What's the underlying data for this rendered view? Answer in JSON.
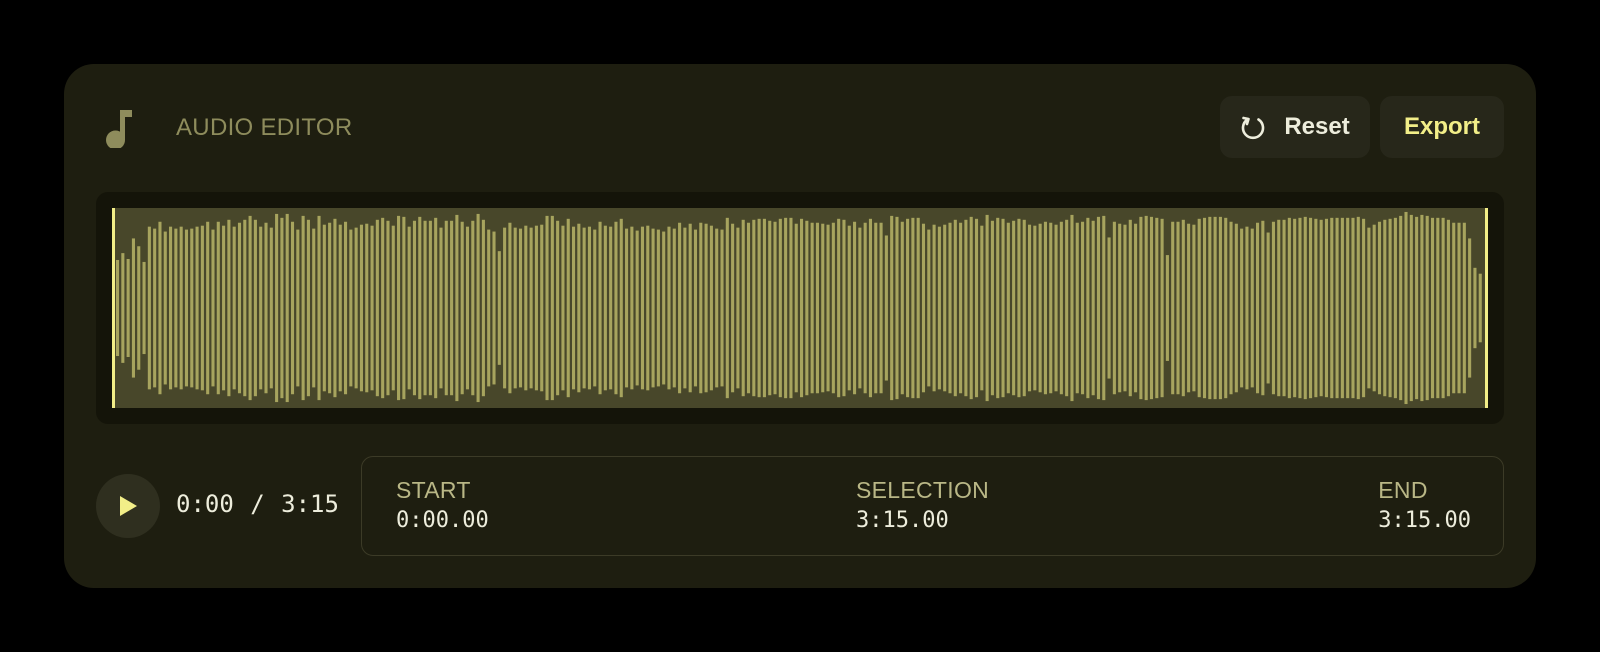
{
  "header": {
    "title": "AUDIO EDITOR",
    "logo_icon": "music-note-icon",
    "reset_label": "Reset",
    "reset_icon": "rotate-ccw-icon",
    "export_label": "Export"
  },
  "waveform": {
    "bar_color": "#a7a45e",
    "selection_fill": "#48472a",
    "handle_color": "#f2ee88",
    "selection_start_fraction": 0.0,
    "selection_end_fraction": 1.0,
    "amplitudes": [
      0.49,
      0.56,
      0.5,
      0.71,
      0.63,
      0.47,
      0.83,
      0.81,
      0.88,
      0.78,
      0.83,
      0.81,
      0.83,
      0.8,
      0.81,
      0.83,
      0.84,
      0.88,
      0.8,
      0.88,
      0.84,
      0.9,
      0.83,
      0.87,
      0.9,
      0.94,
      0.9,
      0.83,
      0.87,
      0.82,
      0.96,
      0.92,
      0.96,
      0.88,
      0.8,
      0.94,
      0.9,
      0.81,
      0.94,
      0.85,
      0.87,
      0.91,
      0.85,
      0.88,
      0.8,
      0.82,
      0.85,
      0.86,
      0.84,
      0.9,
      0.92,
      0.89,
      0.84,
      0.94,
      0.93,
      0.83,
      0.89,
      0.93,
      0.89,
      0.89,
      0.92,
      0.82,
      0.89,
      0.89,
      0.95,
      0.88,
      0.83,
      0.89,
      0.96,
      0.9,
      0.8,
      0.78,
      0.58,
      0.82,
      0.87,
      0.82,
      0.81,
      0.84,
      0.82,
      0.84,
      0.85,
      0.94,
      0.94,
      0.89,
      0.84,
      0.91,
      0.83,
      0.86,
      0.82,
      0.83,
      0.8,
      0.88,
      0.84,
      0.83,
      0.88,
      0.91,
      0.81,
      0.83,
      0.79,
      0.83,
      0.84,
      0.81,
      0.8,
      0.78,
      0.83,
      0.81,
      0.87,
      0.82,
      0.86,
      0.8,
      0.87,
      0.86,
      0.84,
      0.81,
      0.8,
      0.92,
      0.86,
      0.82,
      0.9,
      0.87,
      0.9,
      0.91,
      0.91,
      0.89,
      0.88,
      0.91,
      0.92,
      0.92,
      0.86,
      0.91,
      0.89,
      0.87,
      0.87,
      0.86,
      0.85,
      0.87,
      0.91,
      0.9,
      0.84,
      0.88,
      0.82,
      0.87,
      0.91,
      0.87,
      0.87,
      0.74,
      0.94,
      0.93,
      0.88,
      0.91,
      0.92,
      0.92,
      0.86,
      0.8,
      0.85,
      0.83,
      0.85,
      0.87,
      0.9,
      0.87,
      0.9,
      0.93,
      0.91,
      0.84,
      0.95,
      0.89,
      0.92,
      0.91,
      0.87,
      0.89,
      0.91,
      0.9,
      0.85,
      0.84,
      0.86,
      0.88,
      0.87,
      0.85,
      0.88,
      0.9,
      0.95,
      0.87,
      0.88,
      0.92,
      0.89,
      0.93,
      0.94,
      0.72,
      0.88,
      0.86,
      0.85,
      0.9,
      0.86,
      0.93,
      0.94,
      0.93,
      0.92,
      0.91,
      0.54,
      0.88,
      0.88,
      0.9,
      0.86,
      0.85,
      0.91,
      0.92,
      0.93,
      0.93,
      0.93,
      0.92,
      0.88,
      0.86,
      0.81,
      0.83,
      0.81,
      0.87,
      0.89,
      0.77,
      0.88,
      0.9,
      0.9,
      0.92,
      0.91,
      0.92,
      0.93,
      0.92,
      0.91,
      0.9,
      0.91,
      0.92,
      0.92,
      0.92,
      0.92,
      0.92,
      0.93,
      0.91,
      0.82,
      0.85,
      0.88,
      0.9,
      0.91,
      0.92,
      0.94,
      0.98,
      0.95,
      0.93,
      0.95,
      0.94,
      0.92,
      0.92,
      0.92,
      0.9,
      0.87,
      0.87,
      0.87,
      0.71,
      0.41,
      0.35
    ]
  },
  "playback": {
    "play_icon": "play-icon",
    "current_time": "0:00",
    "separator": "/",
    "total_time": "3:15"
  },
  "selection_info": {
    "start_label": "START",
    "start_value": "0:00.00",
    "selection_label": "SELECTION",
    "selection_value": "3:15.00",
    "end_label": "END",
    "end_value": "3:15.00"
  }
}
